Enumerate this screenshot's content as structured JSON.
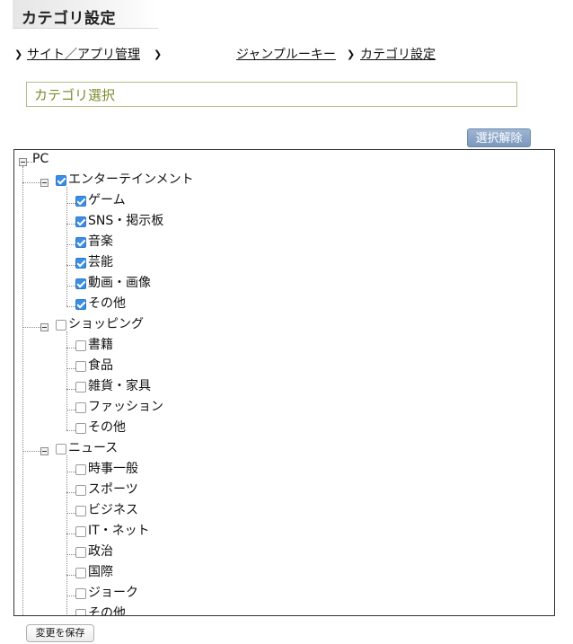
{
  "page_title": "カテゴリ設定",
  "breadcrumb": {
    "sep": "❯",
    "items": [
      "サイト／アプリ管理",
      "ジャンプルーキー",
      "カテゴリ設定"
    ]
  },
  "category_select": {
    "label": "カテゴリ選択"
  },
  "deselect_button": {
    "label": "選択解除",
    "color": "#7b98bd"
  },
  "tree": {
    "root": "PC",
    "groups": [
      {
        "label": "エンターテインメント",
        "checked": true,
        "children": [
          {
            "label": "ゲーム",
            "checked": true
          },
          {
            "label": "SNS・掲示板",
            "checked": true
          },
          {
            "label": "音楽",
            "checked": true
          },
          {
            "label": "芸能",
            "checked": true
          },
          {
            "label": "動画・画像",
            "checked": true
          },
          {
            "label": "その他",
            "checked": true
          }
        ]
      },
      {
        "label": "ショッピング",
        "checked": false,
        "children": [
          {
            "label": "書籍",
            "checked": false
          },
          {
            "label": "食品",
            "checked": false
          },
          {
            "label": "雑貨・家具",
            "checked": false
          },
          {
            "label": "ファッション",
            "checked": false
          },
          {
            "label": "その他",
            "checked": false
          }
        ]
      },
      {
        "label": "ニュース",
        "checked": false,
        "children": [
          {
            "label": "時事一般",
            "checked": false
          },
          {
            "label": "スポーツ",
            "checked": false
          },
          {
            "label": "ビジネス",
            "checked": false
          },
          {
            "label": "IT・ネット",
            "checked": false
          },
          {
            "label": "政治",
            "checked": false
          },
          {
            "label": "国際",
            "checked": false
          },
          {
            "label": "ジョーク",
            "checked": false
          },
          {
            "label": "その他",
            "checked": false
          }
        ]
      }
    ]
  },
  "save_button": {
    "label": "変更を保存"
  },
  "colors": {
    "checked": "#3a8ee6",
    "accent_text": "#7d8a2e",
    "box_border": "#b7bc8a"
  }
}
